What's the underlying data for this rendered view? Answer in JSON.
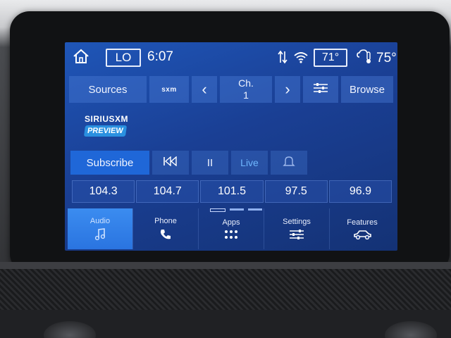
{
  "status": {
    "lo_label": "LO",
    "time": "6:07",
    "cabin_temp": "71°",
    "outside_temp": "75°",
    "icons": [
      "home-icon",
      "signal-arrows-icon",
      "wifi-icon",
      "weather-thermometer-icon"
    ]
  },
  "source_bar": {
    "sources_label": "Sources",
    "sxm_label": "sxm",
    "channel_label": "Ch.",
    "channel_number": "1",
    "browse_label": "Browse"
  },
  "logo": {
    "brand": "SIRIUSXM",
    "badge": "PREVIEW"
  },
  "controls": {
    "subscribe_label": "Subscribe",
    "pause_label": "II",
    "live_label": "Live"
  },
  "presets": [
    "104.3",
    "104.7",
    "101.5",
    "97.5",
    "96.9"
  ],
  "nav": {
    "items": [
      {
        "label": "Audio",
        "icon": "music-note-icon",
        "active": true
      },
      {
        "label": "Phone",
        "icon": "phone-icon",
        "active": false
      },
      {
        "label": "Apps",
        "icon": "apps-grid-icon",
        "active": false
      },
      {
        "label": "Settings",
        "icon": "sliders-icon",
        "active": false
      },
      {
        "label": "Features",
        "icon": "car-icon",
        "active": false
      }
    ]
  },
  "colors": {
    "screen_bg": "#1a3f94",
    "active_nav": "#2a74e0",
    "live_text": "#6fb7ff",
    "subscribe_bg": "#1f67d8"
  }
}
